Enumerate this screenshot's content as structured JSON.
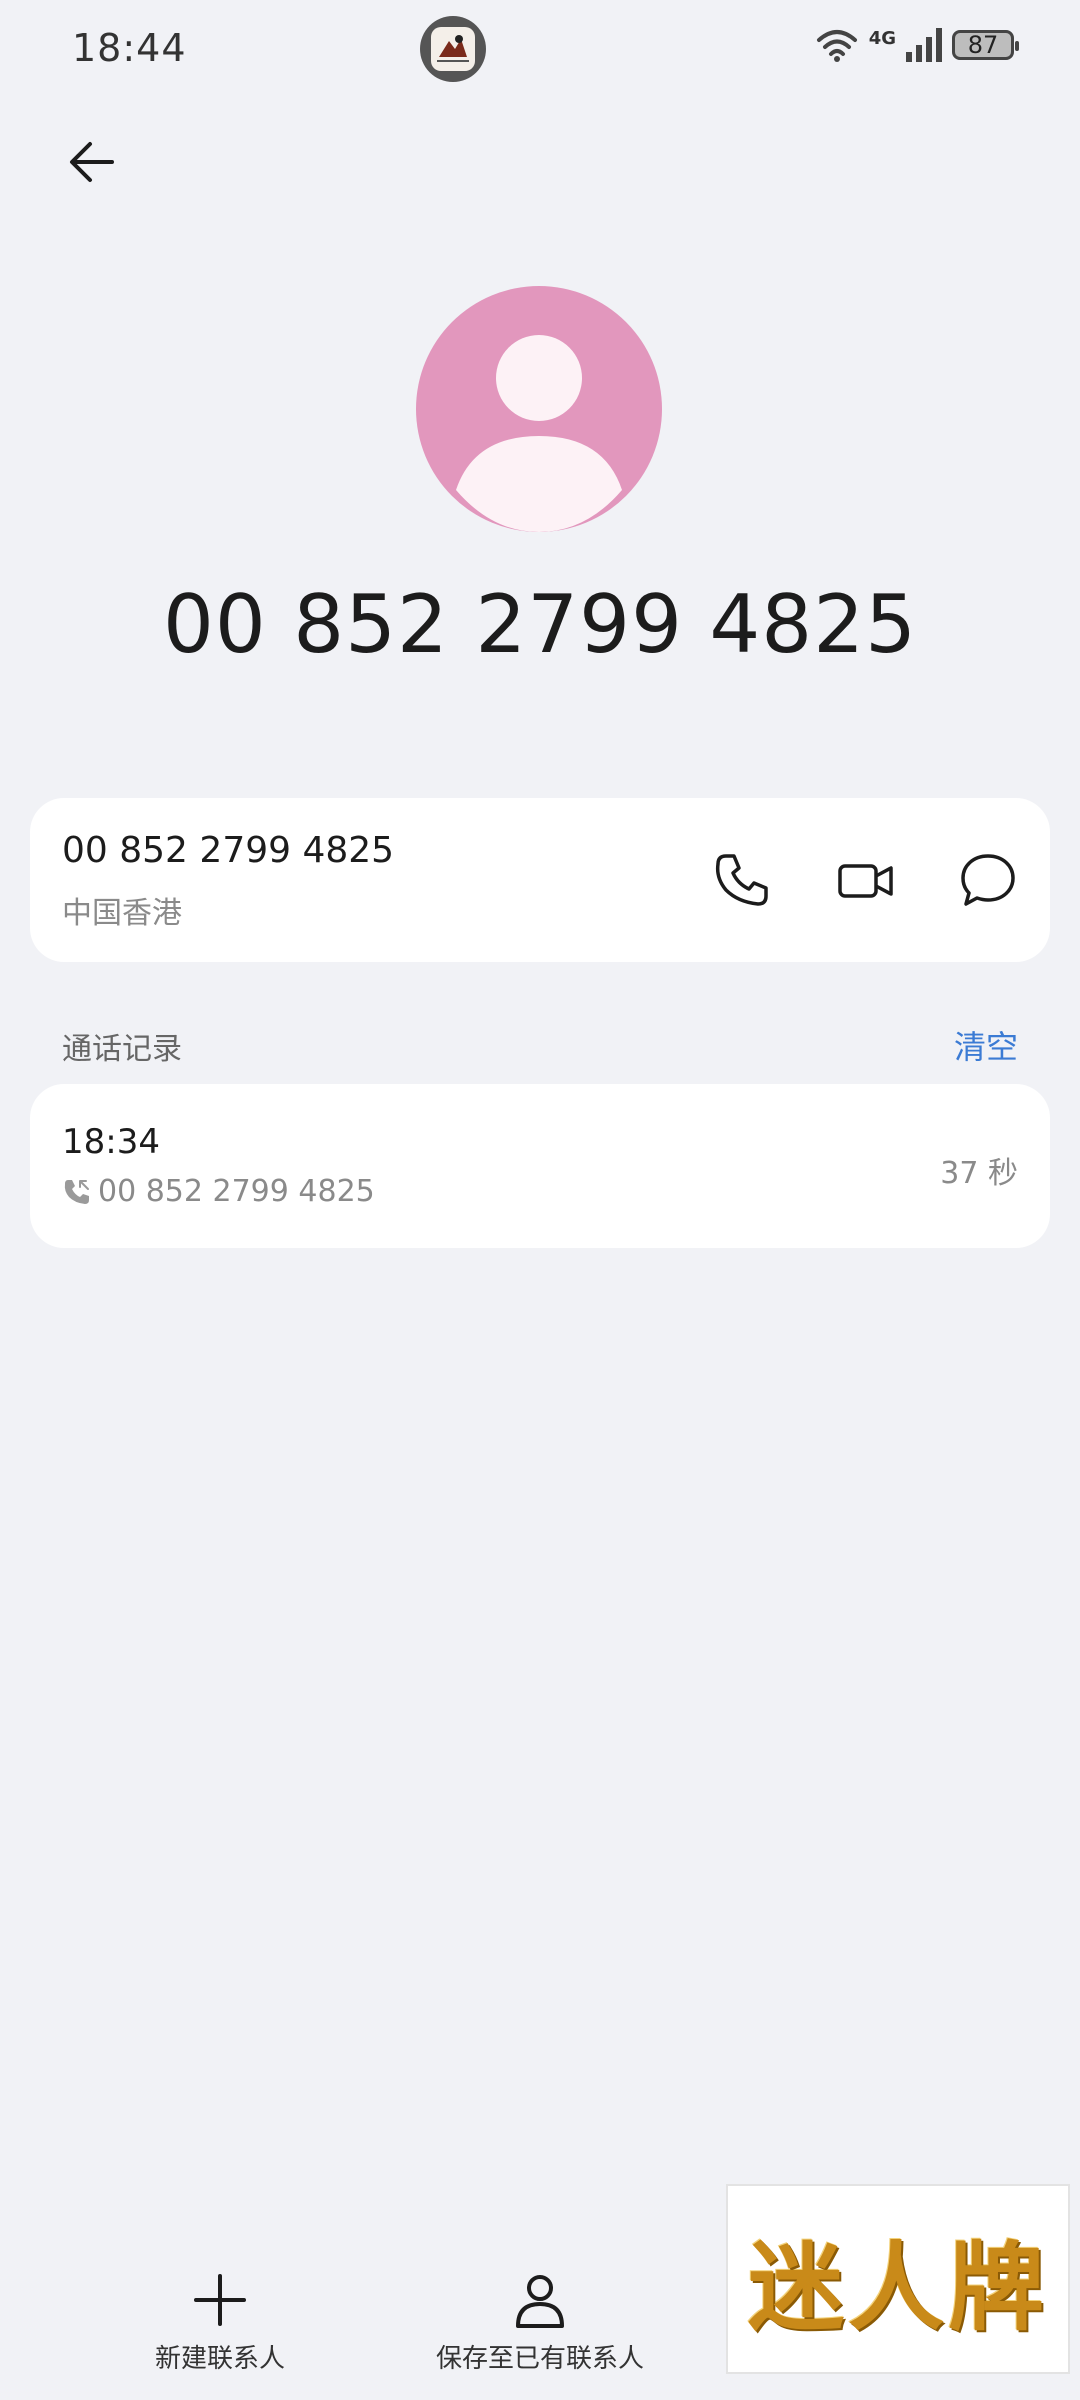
{
  "status_bar": {
    "time": "18:44",
    "network": "4G",
    "battery": "87",
    "icons": [
      "app-notification-icon",
      "wifi-icon",
      "signal-icon",
      "battery-icon"
    ]
  },
  "header": {
    "back_icon": "arrow-left-icon"
  },
  "contact": {
    "avatar_color": "#e297bd",
    "display_number": "00 852 2799 4825",
    "card": {
      "number": "00 852 2799 4825",
      "region": "中国香港",
      "actions": [
        "phone-icon",
        "video-call-icon",
        "message-icon"
      ]
    }
  },
  "call_log": {
    "title": "通话记录",
    "clear_label": "清空",
    "entries": [
      {
        "time": "18:34",
        "number": "00 852 2799 4825",
        "duration": "37 秒",
        "type_icon": "incoming-call-icon"
      }
    ]
  },
  "bottom_bar": {
    "new_contact_label": "新建联系人",
    "save_existing_label": "保存至已有联系人"
  },
  "ad": {
    "text": "迷人牌"
  },
  "colors": {
    "background": "#f1f2f6",
    "card": "#ffffff",
    "accent": "#3b7bd4",
    "secondary_text": "#8a8a8a"
  }
}
